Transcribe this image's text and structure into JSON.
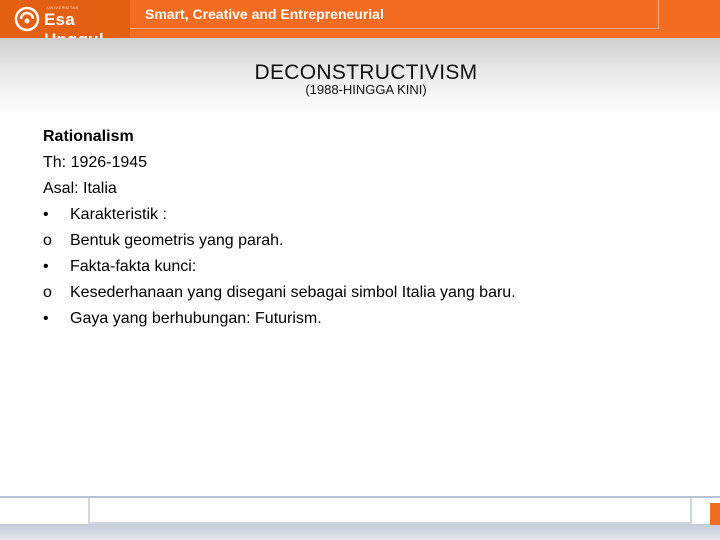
{
  "header": {
    "logo_text": "Esa Unggul",
    "logo_small": "UNIVERSITAS",
    "tagline": "Smart, Creative and Entrepreneurial",
    "brand_color": "#f26d21"
  },
  "slide": {
    "title": "DECONSTRUCTIVISM",
    "subtitle": "(1988-HINGGA KINI)"
  },
  "content": {
    "heading": "Rationalism",
    "year": "Th: 1926-1945",
    "origin": "Asal: Italia",
    "items": [
      {
        "marker": "•",
        "text": "Karakteristik :"
      },
      {
        "marker": "o",
        "text": "Bentuk geometris yang parah."
      },
      {
        "marker": "•",
        "text": "Fakta-fakta kunci:"
      },
      {
        "marker": "o",
        "text": "Kesederhanaan yang disegani sebagai simbol Italia yang baru."
      },
      {
        "marker": "•",
        "text": "Gaya yang berhubungan: Futurism."
      }
    ]
  }
}
